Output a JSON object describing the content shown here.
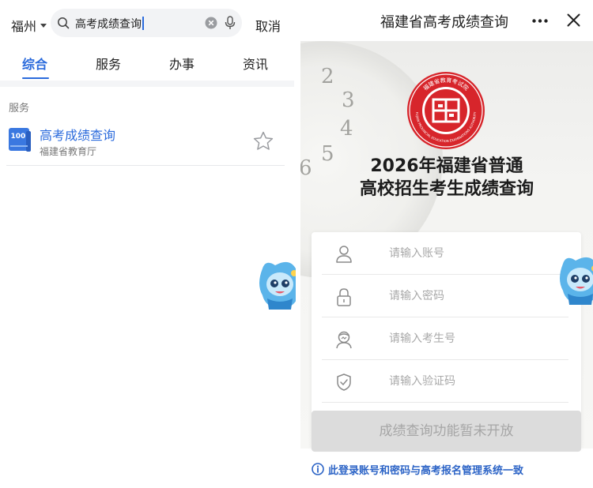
{
  "search_page": {
    "city": "福州",
    "search_query": "高考成绩查询",
    "cancel_label": "取消",
    "tabs": [
      {
        "label": "综合",
        "active": true
      },
      {
        "label": "服务",
        "active": false
      },
      {
        "label": "办事",
        "active": false
      },
      {
        "label": "资讯",
        "active": false
      }
    ],
    "section_title": "服务",
    "result": {
      "title": "高考成绩查询",
      "subtitle": "福建省教育厅",
      "icon_text": "100"
    },
    "accent_color": "#2b6bdc"
  },
  "query_page": {
    "header_title": "福建省高考成绩查询",
    "seal_inner_text": "FUJIAN PROVINCIAL EDUCATION EXAMINATIONS AUTHORITY",
    "seal_chinese": "福建省教育考试院",
    "headline_line1": "2026年福建省普通",
    "headline_line2": "高校招生考生成绩查询",
    "fields": [
      {
        "icon": "user-icon",
        "placeholder": "请输入账号"
      },
      {
        "icon": "lock-icon",
        "placeholder": "请输入密码"
      },
      {
        "icon": "student-icon",
        "placeholder": "请输入考生号"
      },
      {
        "icon": "shield-check-icon",
        "placeholder": "请输入验证码"
      }
    ],
    "submit_label": "成绩查询功能暂未开放",
    "notice": "此登录账号和密码与高考报名管理系统一致",
    "seal_color": "#d7252b",
    "notice_color": "#2b63c6"
  }
}
